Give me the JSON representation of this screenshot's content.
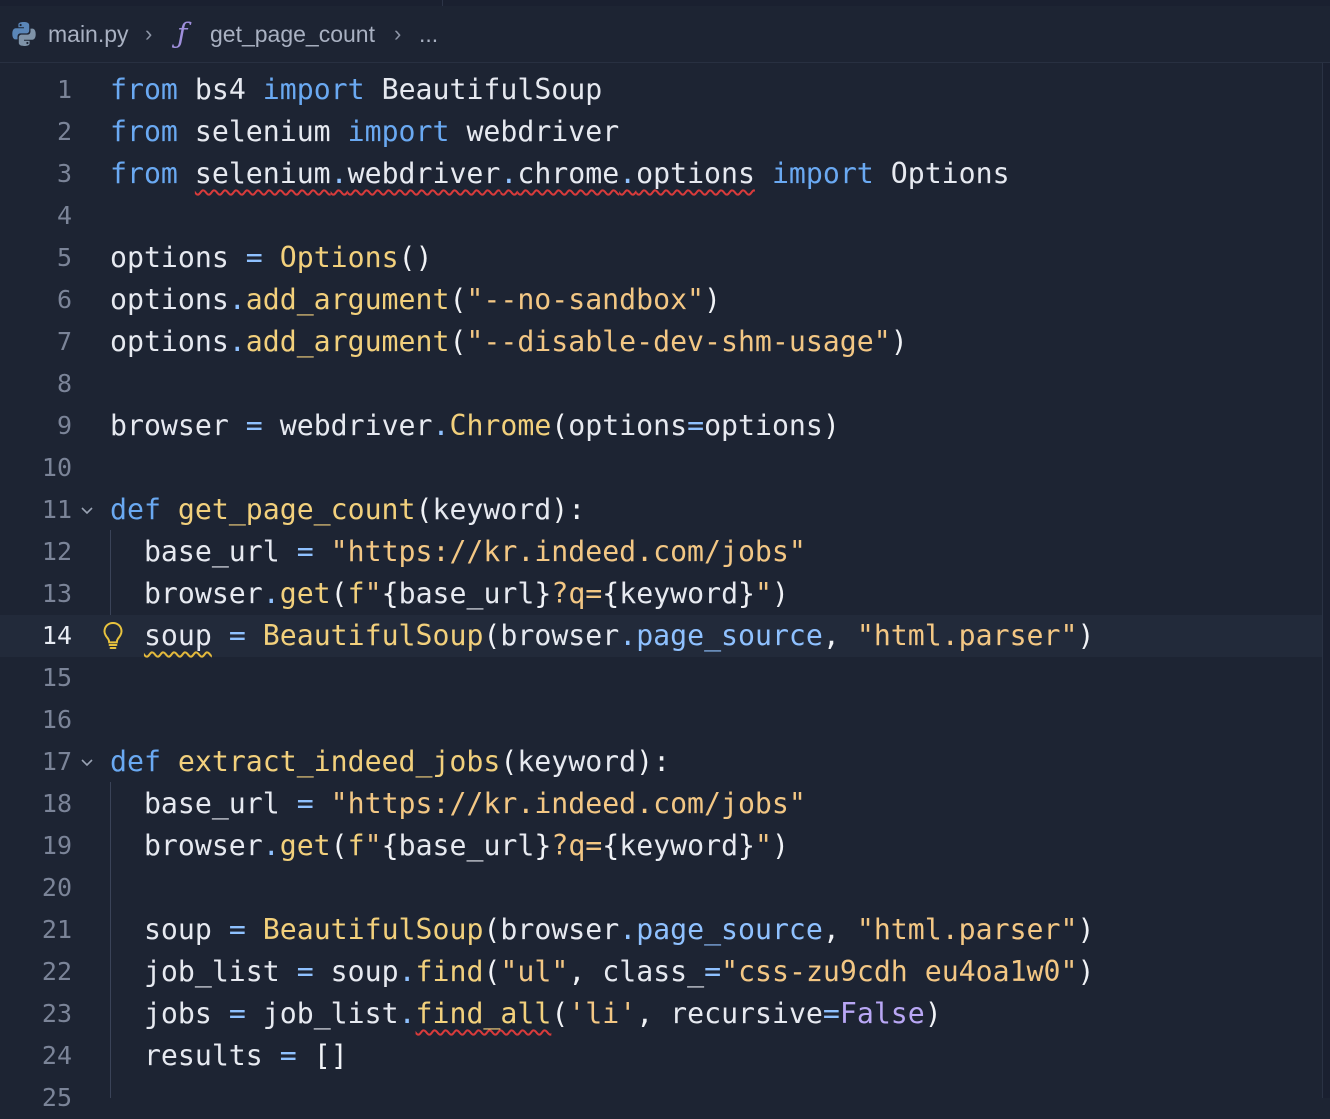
{
  "breadcrumb": {
    "file": "main.py",
    "symbol_glyph": "ƒ",
    "symbol": "get_page_count",
    "ellipsis": "...",
    "separator": "›"
  },
  "editor": {
    "active_line": 14,
    "lines": [
      {
        "n": "1",
        "code": "from bs4 import BeautifulSoup"
      },
      {
        "n": "2",
        "code": "from selenium import webdriver"
      },
      {
        "n": "3",
        "code": "from selenium.webdriver.chrome.options import Options"
      },
      {
        "n": "4",
        "code": ""
      },
      {
        "n": "5",
        "code": "options = Options()"
      },
      {
        "n": "6",
        "code": "options.add_argument(\"--no-sandbox\")"
      },
      {
        "n": "7",
        "code": "options.add_argument(\"--disable-dev-shm-usage\")"
      },
      {
        "n": "8",
        "code": ""
      },
      {
        "n": "9",
        "code": "browser = webdriver.Chrome(options=options)"
      },
      {
        "n": "10",
        "code": ""
      },
      {
        "n": "11",
        "code": "def get_page_count(keyword):"
      },
      {
        "n": "12",
        "code": "  base_url = \"https://kr.indeed.com/jobs\""
      },
      {
        "n": "13",
        "code": "  browser.get(f\"{base_url}?q={keyword}\")"
      },
      {
        "n": "14",
        "code": "  soup = BeautifulSoup(browser.page_source, \"html.parser\")"
      },
      {
        "n": "15",
        "code": ""
      },
      {
        "n": "16",
        "code": ""
      },
      {
        "n": "17",
        "code": "def extract_indeed_jobs(keyword):"
      },
      {
        "n": "18",
        "code": "  base_url = \"https://kr.indeed.com/jobs\""
      },
      {
        "n": "19",
        "code": "  browser.get(f\"{base_url}?q={keyword}\")"
      },
      {
        "n": "20",
        "code": ""
      },
      {
        "n": "21",
        "code": "  soup = BeautifulSoup(browser.page_source, \"html.parser\")"
      },
      {
        "n": "22",
        "code": "  job_list = soup.find(\"ul\", class_=\"css-zu9cdh eu4oa1w0\")"
      },
      {
        "n": "23",
        "code": "  jobs = job_list.find_all('li', recursive=False)"
      },
      {
        "n": "24",
        "code": "  results = []"
      },
      {
        "n": "25",
        "code": ""
      }
    ]
  },
  "colors": {
    "background": "#1d2433",
    "keyword": "#6aa9f2",
    "function": "#f2d07c",
    "string": "#f3c784",
    "error_squiggle": "#d93b3b",
    "warning_squiggle": "#e3b93c"
  },
  "icons": [
    "python-file-icon",
    "function-symbol-icon",
    "chevron-right-icon",
    "fold-chevron-icon",
    "lightbulb-icon"
  ]
}
